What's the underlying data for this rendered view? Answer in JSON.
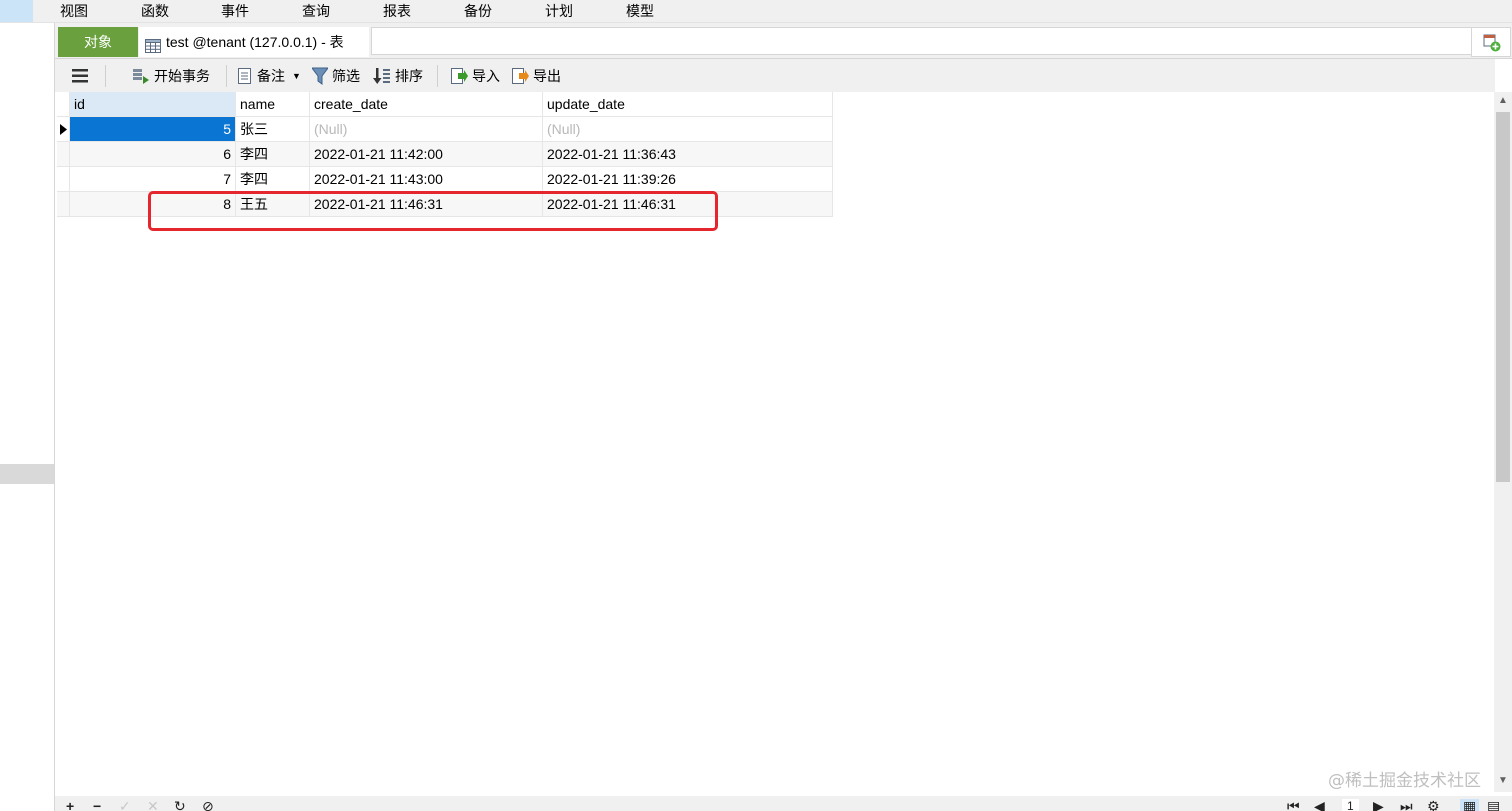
{
  "menu": {
    "items": [
      "视图",
      "函数",
      "事件",
      "查询",
      "报表",
      "备份",
      "计划",
      "模型"
    ]
  },
  "tabs": {
    "objects_label": "对象",
    "table_tab_label": "test @tenant (127.0.0.1) - 表"
  },
  "toolbar": {
    "begin_transaction": "开始事务",
    "notes": "备注",
    "filter": "筛选",
    "sort": "排序",
    "import": "导入",
    "export": "导出"
  },
  "grid": {
    "columns": [
      "id",
      "name",
      "create_date",
      "update_date"
    ],
    "rows": [
      {
        "id": "5",
        "name": "张三",
        "create_date": "(Null)",
        "update_date": "(Null)"
      },
      {
        "id": "6",
        "name": "李四",
        "create_date": "2022-01-21 11:42:00",
        "update_date": "2022-01-21 11:36:43"
      },
      {
        "id": "7",
        "name": "李四",
        "create_date": "2022-01-21 11:43:00",
        "update_date": "2022-01-21 11:39:26"
      },
      {
        "id": "8",
        "name": "王五",
        "create_date": "2022-01-21 11:46:31",
        "update_date": "2022-01-21 11:46:31"
      }
    ]
  },
  "bottom": {
    "page_number": "1"
  },
  "watermark": "@稀土掘金技术社区",
  "colors": {
    "objects_tab": "#6aa13e",
    "selection": "#0a75d3",
    "highlight_box": "#e5262f"
  }
}
